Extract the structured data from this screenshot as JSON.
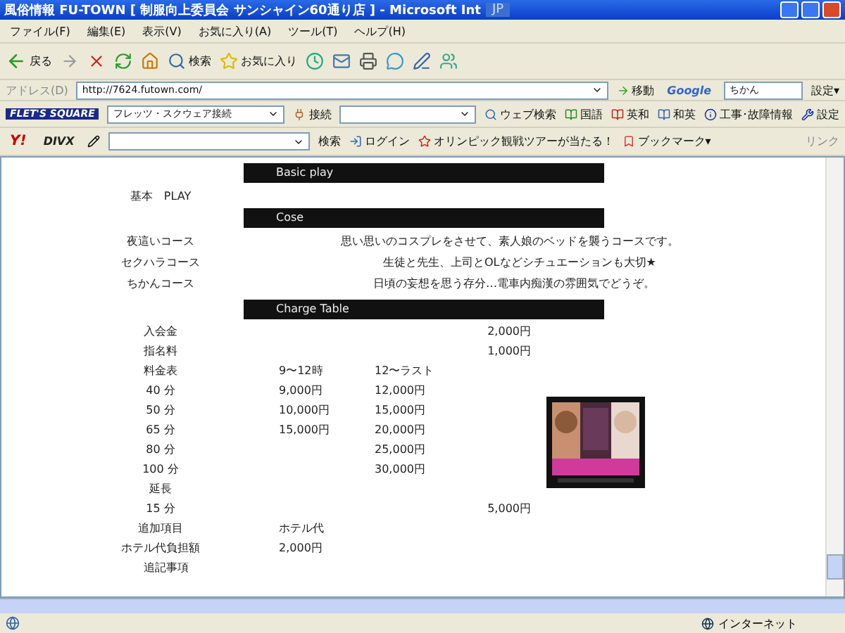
{
  "window": {
    "title": "風俗情報 FU-TOWN [ 制服向上委員会 サンシャイン60通り店 ] - Microsoft Int",
    "ime": "JP"
  },
  "menu": [
    "ファイル(F)",
    "編集(E)",
    "表示(V)",
    "お気に入り(A)",
    "ツール(T)",
    "ヘルプ(H)"
  ],
  "toolbar": [
    {
      "kind": "back",
      "label": "戻る"
    },
    {
      "kind": "forward"
    },
    {
      "kind": "stop"
    },
    {
      "kind": "refresh"
    },
    {
      "kind": "home"
    },
    {
      "kind": "search",
      "label": "検索"
    },
    {
      "kind": "favorites",
      "label": "お気に入り"
    },
    {
      "kind": "history"
    },
    {
      "kind": "mail"
    },
    {
      "kind": "print"
    },
    {
      "kind": "messenger"
    },
    {
      "kind": "edit"
    },
    {
      "kind": "people"
    }
  ],
  "address": {
    "label": "アドレス(D)",
    "url": "http://7624.futown.com/",
    "go": "移動",
    "google": "Google",
    "google_query": "ちかん",
    "settings": "設定▾"
  },
  "flets_bar": {
    "logo": "FLET'S SQUARE",
    "connection": "フレッツ・スクウェア接続",
    "connect": "接続",
    "web_search": "ウェブ検索",
    "items": [
      "国語",
      "英和",
      "和英"
    ],
    "info": "工事･故障情報",
    "settings": "設定"
  },
  "yahoo_bar": {
    "logo": "Y!",
    "divx": "DIVX",
    "search": "検索",
    "login": "ログイン",
    "promo": "オリンピック観戦ツアーが当たる！",
    "bookmarks": "ブックマーク▾",
    "links": "リンク"
  },
  "basic": {
    "header": "Basic play",
    "rows": [
      "基本　PLAY"
    ]
  },
  "courses": {
    "header": "Cose",
    "rows": [
      {
        "name": "夜這いコース",
        "text": "思い思いのコスプレをさせて、素人娘のベッドを襲うコースです。"
      },
      {
        "name": "セクハラコース",
        "text": "生徒と先生、上司とOLなどシチュエーションも大切★"
      },
      {
        "name": "ちかんコース",
        "text": "日頃の妄想を思う存分…電車内痴漢の雰囲気でどうぞ。"
      }
    ]
  },
  "charge_table": {
    "header": "Charge Table",
    "rows": [
      {
        "label": "入会金",
        "column_4": "2,000円"
      },
      {
        "label": "指名料",
        "column_4": "1,000円"
      },
      {
        "label": "料金表",
        "column_2": "9〜12時",
        "column_3": "12〜ラスト"
      },
      {
        "label": "40 分",
        "column_2": "9,000円",
        "column_3": "12,000円"
      },
      {
        "label": "50 分",
        "column_2": "10,000円",
        "column_3": "15,000円"
      },
      {
        "label": "65 分",
        "column_2": "15,000円",
        "column_3": "20,000円"
      },
      {
        "label": "80 分",
        "column_3": "25,000円"
      },
      {
        "label": "100 分",
        "column_3": "30,000円"
      },
      {
        "label": "延長"
      },
      {
        "label": "15 分",
        "column_4": "5,000円"
      },
      {
        "label": "追加項目",
        "column_2": "ホテル代"
      },
      {
        "label": "ホテル代負担額",
        "column_2": "2,000円"
      }
    ]
  },
  "notes_heading": "追記事項",
  "status_bar": {
    "zone": "インターネット"
  }
}
